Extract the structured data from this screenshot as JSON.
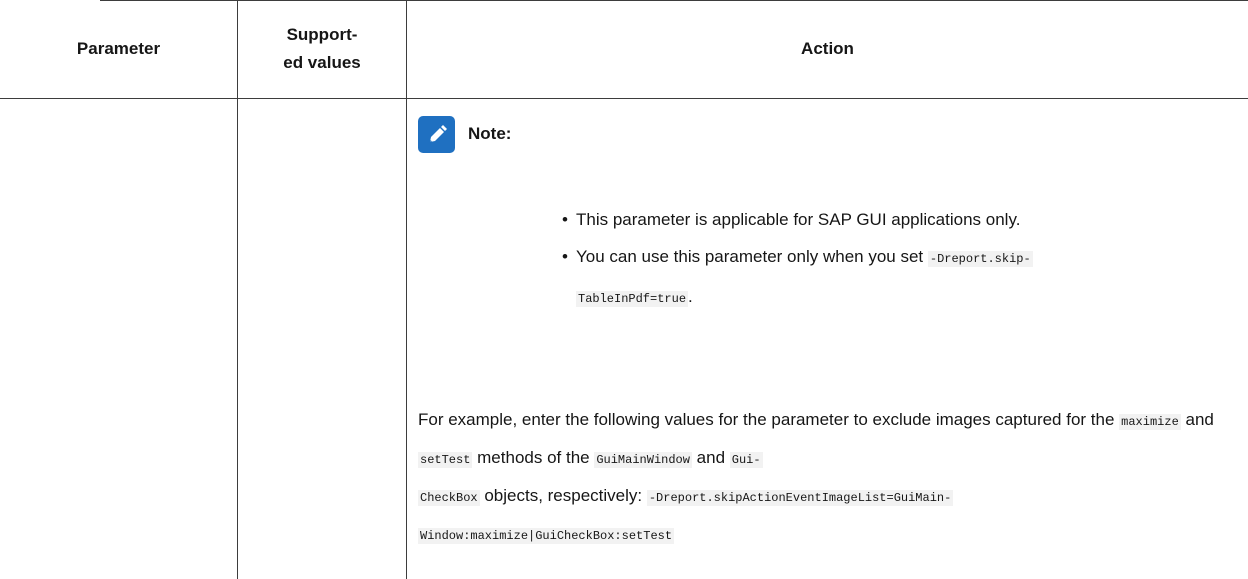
{
  "table": {
    "headers": {
      "parameter": "Parameter",
      "supported_line1": "Support-",
      "supported_line2": "ed values",
      "action": "Action"
    }
  },
  "note": {
    "icon": "pencil-note-icon",
    "label": "Note:",
    "icon_color": "#1f70c1"
  },
  "bullets": {
    "b1": "This parameter is applicable for SAP GUI applications only.",
    "b2_pre": "You can use this parameter only when you set ",
    "b2_code_1": "-Dreport.skip-",
    "b2_code_2": "TableInPdf=true",
    "b2_post": "."
  },
  "example": {
    "t1": "For example, enter the following values for the parameter to exclude images captured for the ",
    "c1": "maximize",
    "t2": " and ",
    "c2": "setTest",
    "t3": " methods of the ",
    "c3": "GuiMainWindow",
    "t4": " and ",
    "c4a": "Gui-",
    "c4b": "CheckBox",
    "t5": " objects, respectively: ",
    "c5a": "-Dreport.skipActionEventImageList=GuiMain-",
    "c5b": "Window:maximize|GuiCheckBox:setTest"
  }
}
